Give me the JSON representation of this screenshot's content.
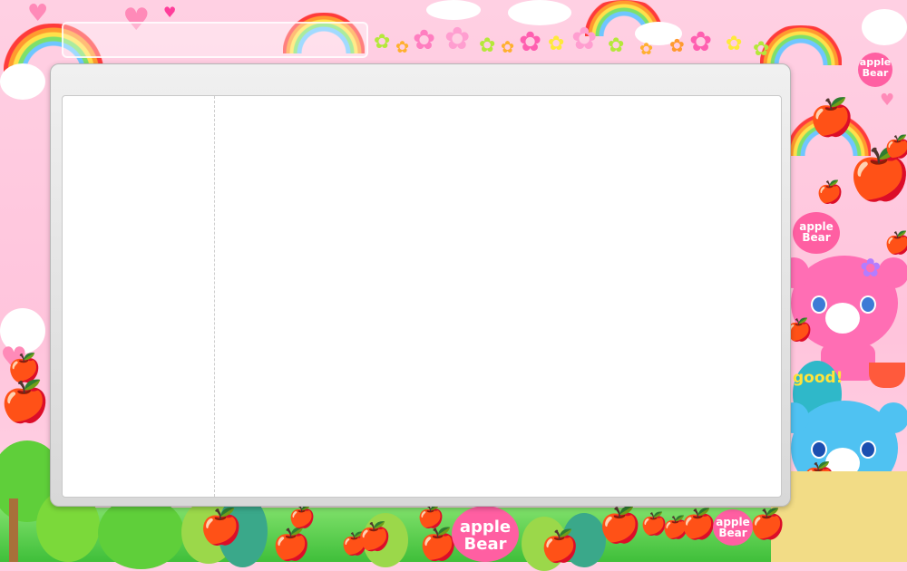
{
  "colors": {
    "background": "#ffc4dc",
    "window": "#e6e6e6",
    "content": "#ffffff"
  },
  "decor": {
    "badges": [
      "apple",
      "Bear"
    ],
    "balloon": "good!",
    "icons": [
      "rainbow-icon",
      "cloud-icon",
      "flower-icon",
      "apple-icon",
      "heart-icon",
      "bear-icon",
      "tree-icon"
    ]
  }
}
